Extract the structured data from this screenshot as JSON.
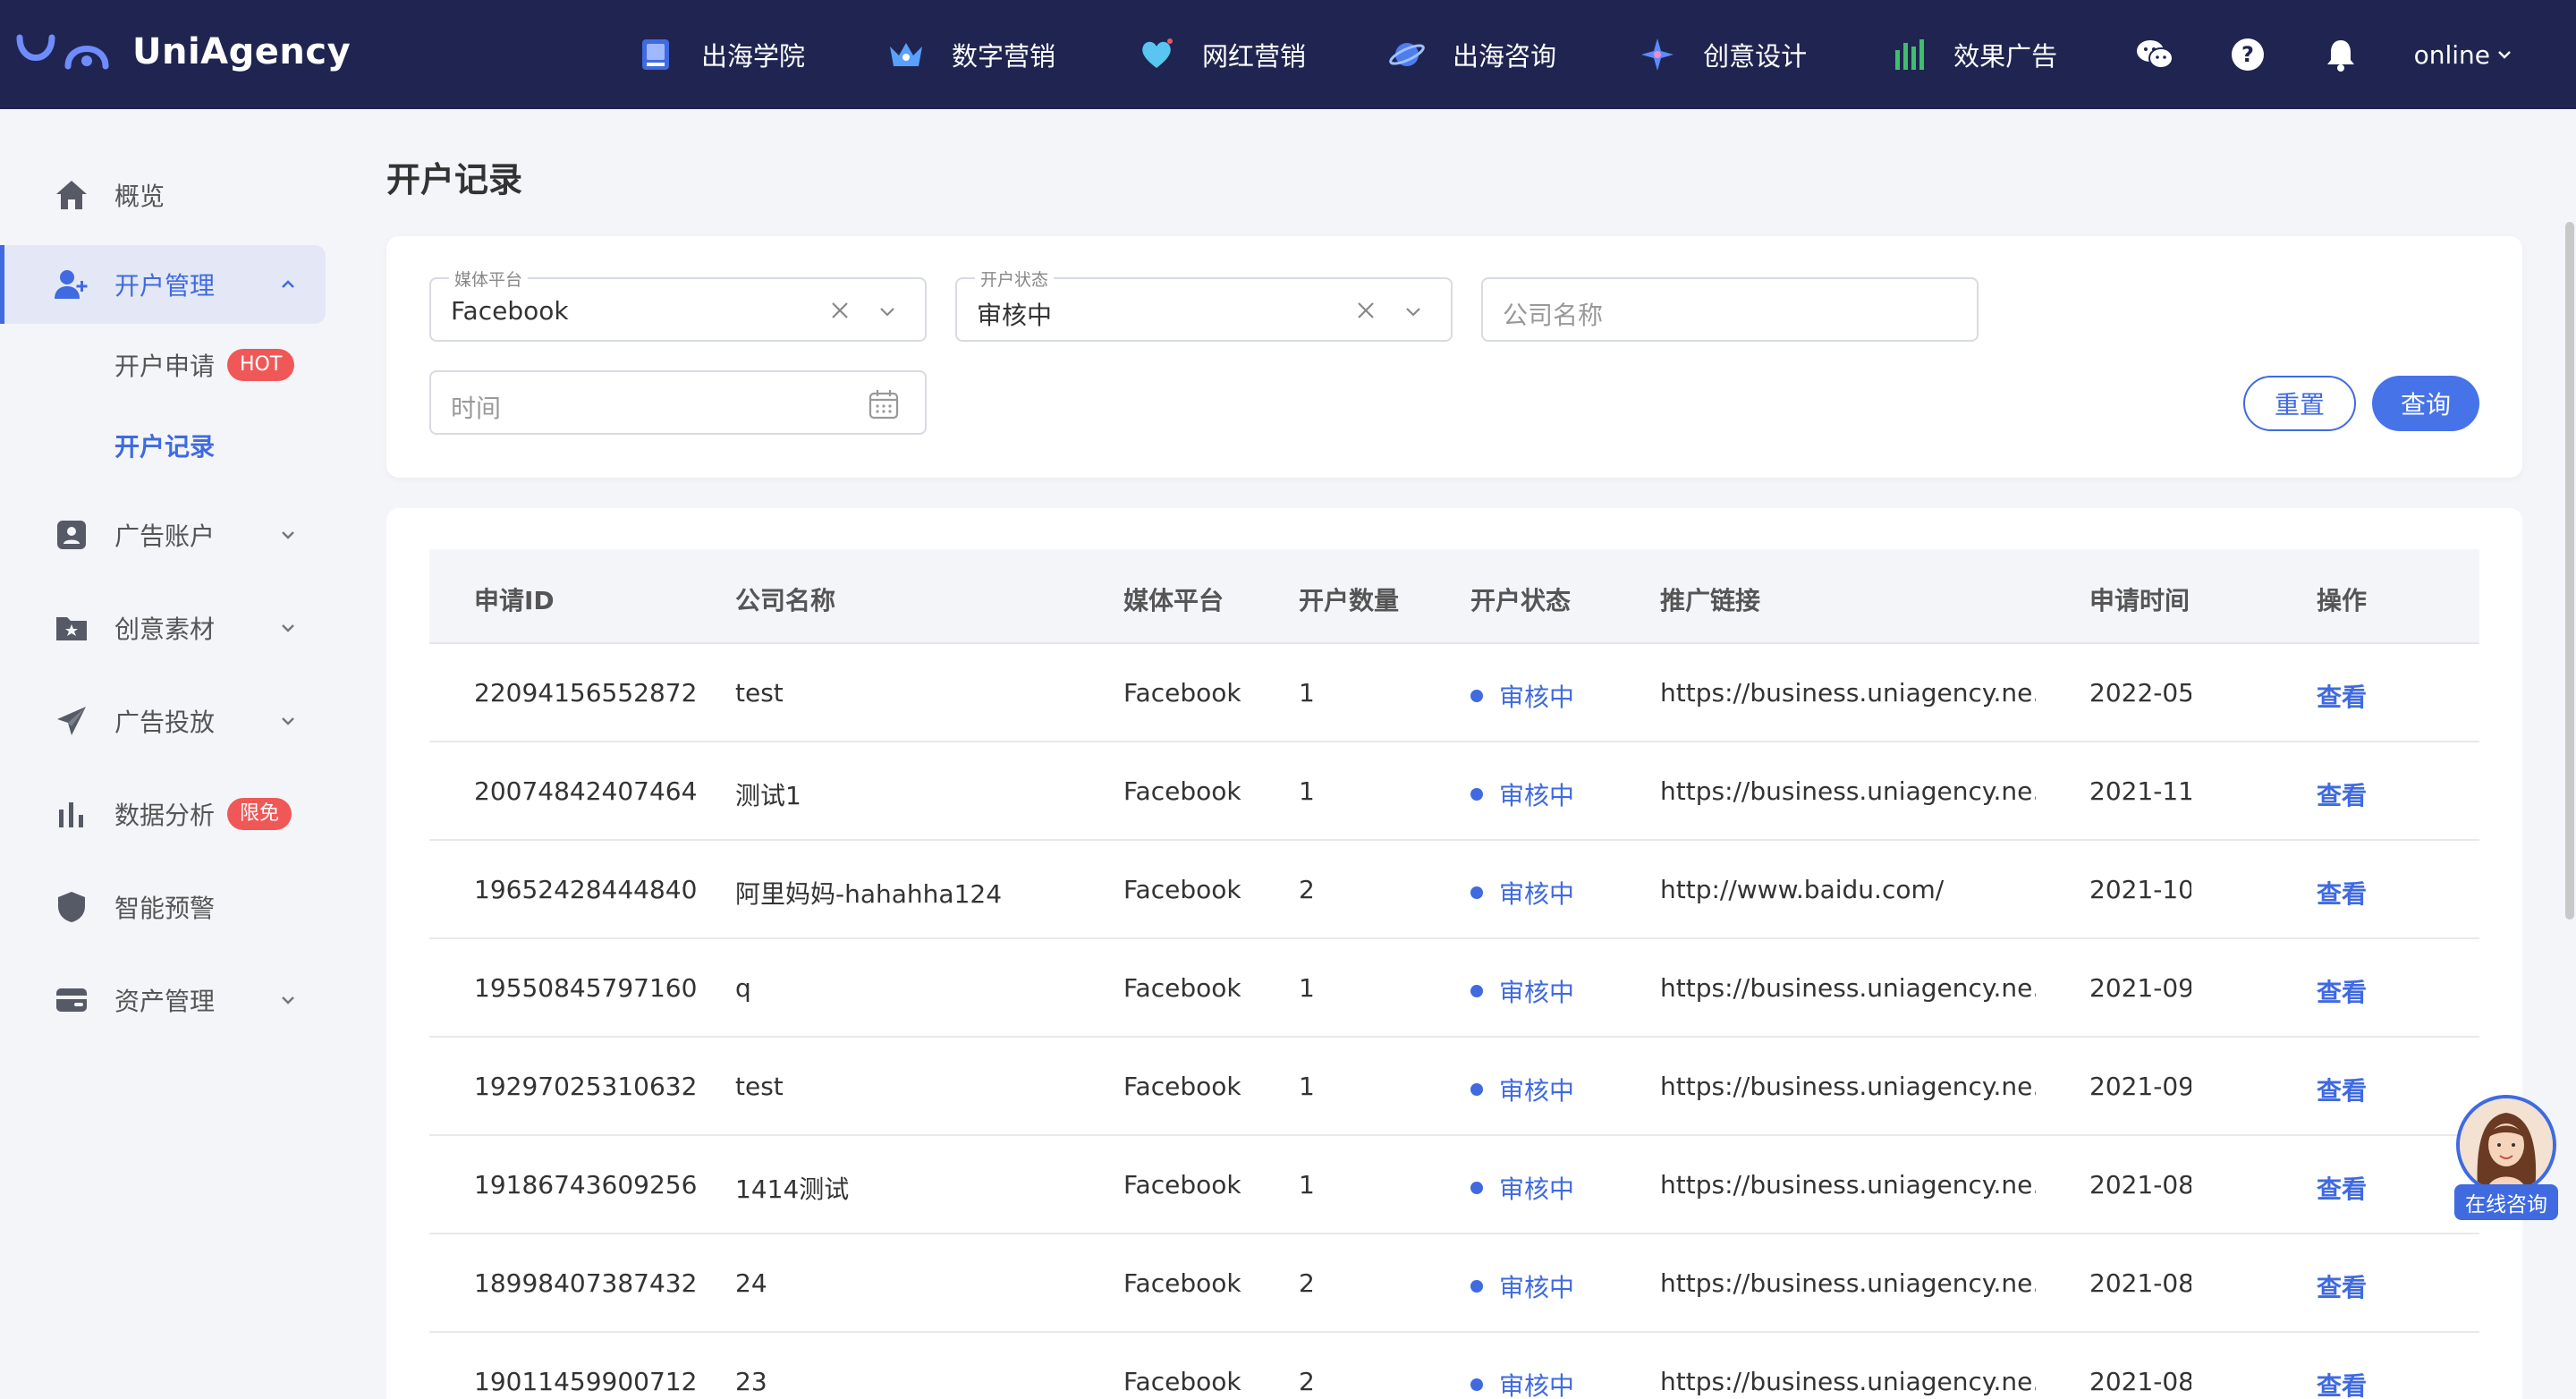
{
  "brand": {
    "name": "UniAgency"
  },
  "topnav": [
    {
      "label": "出海学院",
      "icon": "book-icon"
    },
    {
      "label": "数字营销",
      "icon": "crown-icon"
    },
    {
      "label": "网红营销",
      "icon": "heart-icon"
    },
    {
      "label": "出海咨询",
      "icon": "planet-icon"
    },
    {
      "label": "创意设计",
      "icon": "sparkle-icon"
    },
    {
      "label": "效果广告",
      "icon": "chart-plant-icon"
    }
  ],
  "user": {
    "status": "online"
  },
  "sidebar": {
    "items": [
      {
        "label": "概览"
      },
      {
        "label": "开户管理"
      },
      {
        "label": "广告账户"
      },
      {
        "label": "创意素材"
      },
      {
        "label": "广告投放"
      },
      {
        "label": "数据分析",
        "badge": "限免"
      },
      {
        "label": "智能预警"
      },
      {
        "label": "资产管理"
      }
    ],
    "sub": [
      {
        "label": "开户申请",
        "badge": "HOT"
      },
      {
        "label": "开户记录"
      }
    ]
  },
  "page": {
    "title": "开户记录"
  },
  "filters": {
    "platform": {
      "label": "媒体平台",
      "value": "Facebook"
    },
    "status": {
      "label": "开户状态",
      "value": "审核中"
    },
    "company": {
      "placeholder": "公司名称"
    },
    "time": {
      "placeholder": "时间"
    },
    "reset_label": "重置",
    "query_label": "查询"
  },
  "table": {
    "headers": [
      "申请ID",
      "公司名称",
      "媒体平台",
      "开户数量",
      "开户状态",
      "推广链接",
      "申请时间",
      "操作"
    ],
    "rows": [
      {
        "id": "22094156552872",
        "company": "test",
        "platform": "Facebook",
        "count": "1",
        "status": "审核中",
        "link": "https://business.uniagency.ne...",
        "time": "2022-05-",
        "action": "查看"
      },
      {
        "id": "20074842407464",
        "company": "测试1",
        "platform": "Facebook",
        "count": "1",
        "status": "审核中",
        "link": "https://business.uniagency.ne...",
        "time": "2021-11-",
        "action": "查看"
      },
      {
        "id": "19652428444840",
        "company": "阿里妈妈-hahahha124",
        "platform": "Facebook",
        "count": "2",
        "status": "审核中",
        "link": "http://www.baidu.com/",
        "time": "2021-10-",
        "action": "查看"
      },
      {
        "id": "19550845797160",
        "company": "q",
        "platform": "Facebook",
        "count": "1",
        "status": "审核中",
        "link": "https://business.uniagency.ne...",
        "time": "2021-09-",
        "action": "查看"
      },
      {
        "id": "19297025310632",
        "company": "test",
        "platform": "Facebook",
        "count": "1",
        "status": "审核中",
        "link": "https://business.uniagency.ne...",
        "time": "2021-09-",
        "action": "查看"
      },
      {
        "id": "19186743609256",
        "company": "1414测试",
        "platform": "Facebook",
        "count": "1",
        "status": "审核中",
        "link": "https://business.uniagency.ne...",
        "time": "2021-08-",
        "action": "查看"
      },
      {
        "id": "18998407387432",
        "company": "24",
        "platform": "Facebook",
        "count": "2",
        "status": "审核中",
        "link": "https://business.uniagency.ne...",
        "time": "2021-08-",
        "action": "查看"
      },
      {
        "id": "19011459900712",
        "company": "23",
        "platform": "Facebook",
        "count": "2",
        "status": "审核中",
        "link": "https://business.uniagency.ne...",
        "time": "2021-08-",
        "action": "查看"
      }
    ]
  },
  "chat": {
    "label": "在线咨询"
  },
  "colors": {
    "topbar": "#1f2550",
    "accent": "#3f6ae0",
    "badge": "#f05858",
    "background": "#f4f5f9"
  }
}
